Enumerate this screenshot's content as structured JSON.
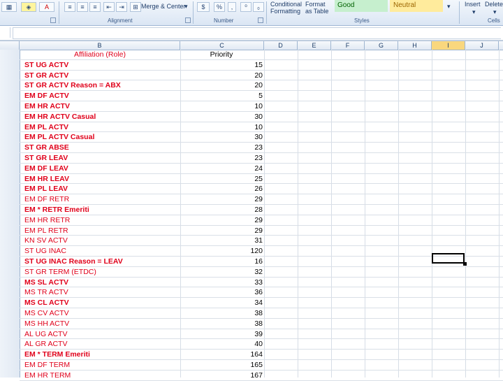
{
  "ribbon": {
    "buttons": {
      "merge_center": "Merge & Center",
      "percent": "%",
      "comma": ",",
      "conditional_formatting_line1": "Conditional",
      "conditional_formatting_line2": "Formatting",
      "format_table_line1": "Format",
      "format_table_line2": "as Table",
      "style_good": "Good",
      "style_neutral": "Neutral",
      "insert": "Insert",
      "delete": "Delete"
    },
    "groups": {
      "alignment": "Alignment",
      "number": "Number",
      "styles": "Styles",
      "cells": "Cells"
    }
  },
  "columns": [
    "B",
    "C",
    "D",
    "E",
    "F",
    "G",
    "H",
    "I",
    "J"
  ],
  "selected_column": "I",
  "header_row": {
    "affiliation": "Affiliation (Role)",
    "priority": "Priority"
  },
  "rows": [
    {
      "role": "ST UG ACTV",
      "priority": "15",
      "bold": true
    },
    {
      "role": "ST GR ACTV",
      "priority": "20",
      "bold": true
    },
    {
      "role": "ST GR ACTV Reason = ABX",
      "priority": "20",
      "bold": true
    },
    {
      "role": "EM DF ACTV",
      "priority": "5",
      "bold": true
    },
    {
      "role": "EM HR ACTV",
      "priority": "10",
      "bold": true
    },
    {
      "role": "EM HR ACTV Casual",
      "priority": "30",
      "bold": true
    },
    {
      "role": "EM PL ACTV",
      "priority": "10",
      "bold": true
    },
    {
      "role": "EM PL ACTV Casual",
      "priority": "30",
      "bold": true
    },
    {
      "role": "ST GR ABSE",
      "priority": "23",
      "bold": true
    },
    {
      "role": "ST GR LEAV",
      "priority": "23",
      "bold": true
    },
    {
      "role": "EM DF LEAV",
      "priority": "24",
      "bold": true
    },
    {
      "role": "EM HR LEAV",
      "priority": "25",
      "bold": true
    },
    {
      "role": "EM PL LEAV",
      "priority": "26",
      "bold": true
    },
    {
      "role": "EM DF RETR",
      "priority": "29",
      "bold": false
    },
    {
      "role": "EM * RETR Emeriti",
      "priority": "28",
      "bold": true
    },
    {
      "role": "EM HR RETR",
      "priority": "29",
      "bold": false
    },
    {
      "role": "EM PL RETR",
      "priority": "29",
      "bold": false
    },
    {
      "role": "KN SV ACTV",
      "priority": "31",
      "bold": false
    },
    {
      "role": "ST UG INAC",
      "priority": "120",
      "bold": false
    },
    {
      "role": "ST UG INAC Reason = LEAV",
      "priority": "16",
      "bold": true
    },
    {
      "role": "ST GR TERM (ETDC)",
      "priority": "32",
      "bold": false
    },
    {
      "role": "MS SL ACTV",
      "priority": "33",
      "bold": true
    },
    {
      "role": "MS TR ACTV",
      "priority": "36",
      "bold": false
    },
    {
      "role": "MS CL ACTV",
      "priority": "34",
      "bold": true
    },
    {
      "role": "MS CV ACTV",
      "priority": "38",
      "bold": false
    },
    {
      "role": "MS HH ACTV",
      "priority": "38",
      "bold": false
    },
    {
      "role": "AL UG ACTV",
      "priority": "39",
      "bold": false
    },
    {
      "role": "AL GR ACTV",
      "priority": "40",
      "bold": false
    },
    {
      "role": "EM * TERM Emeriti",
      "priority": "164",
      "bold": true
    },
    {
      "role": "EM DF TERM",
      "priority": "165",
      "bold": false
    },
    {
      "role": "EM HR TERM",
      "priority": "167",
      "bold": false
    }
  ]
}
